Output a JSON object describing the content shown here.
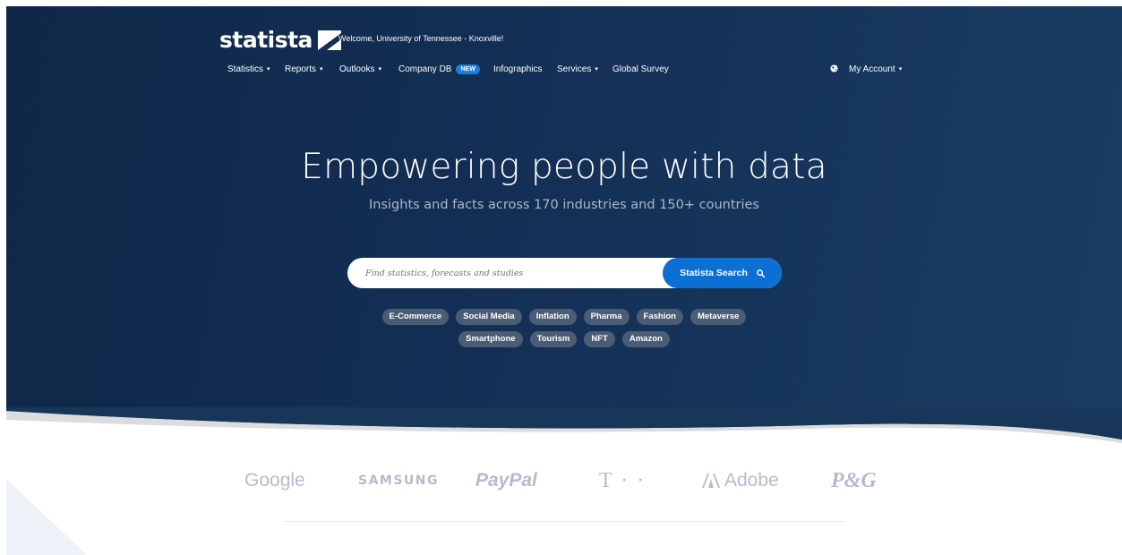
{
  "header": {
    "logo_text": "statista",
    "welcome": "Welcome, University of Tennessee - Knoxville!",
    "nav": [
      {
        "label": "Statistics",
        "caret": true
      },
      {
        "label": "Reports",
        "caret": true
      },
      {
        "label": "Outlooks",
        "caret": true
      },
      {
        "label": "Company DB",
        "caret": false,
        "badge": "NEW"
      },
      {
        "label": "Infographics",
        "caret": false
      },
      {
        "label": "Services",
        "caret": true
      },
      {
        "label": "Global Survey",
        "caret": false
      }
    ],
    "account_label": "My Account",
    "caret_glyph": "▾"
  },
  "hero": {
    "title": "Empowering people with data",
    "subtitle": "Insights and facts across 170 industries and 150+ countries"
  },
  "search": {
    "placeholder": "Find statistics, forecasts and studies",
    "button_label": "Statista Search"
  },
  "tags": {
    "row1": [
      "E-Commerce",
      "Social Media",
      "Inflation",
      "Pharma",
      "Fashion",
      "Metaverse"
    ],
    "row2": [
      "Smartphone",
      "Tourism",
      "NFT",
      "Amazon"
    ]
  },
  "brands": {
    "google": "Google",
    "samsung": "SAMSUNG",
    "paypal": "PayPal",
    "telekom": "T · ·",
    "adobe": "Adobe",
    "pg": "P&G"
  },
  "colors": {
    "hero_bg": "#132f55",
    "accent": "#0b6fd3",
    "tag_bg": "#4b5d74",
    "brand_gray": "#b3bccb"
  }
}
